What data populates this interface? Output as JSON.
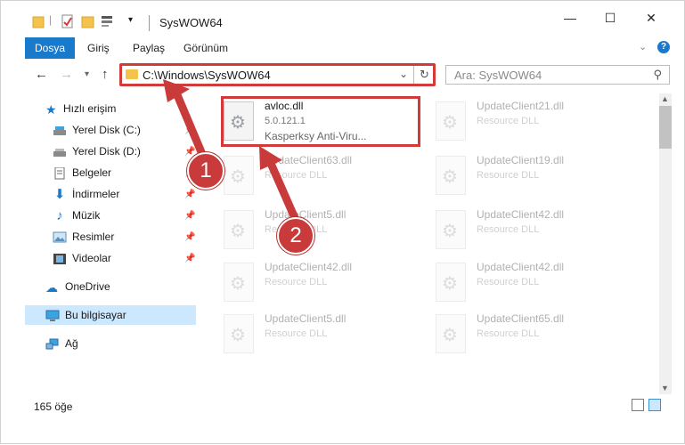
{
  "window": {
    "title": "SysWOW64"
  },
  "window_controls": {
    "minimize": "—",
    "maximize": "☐",
    "close": "✕"
  },
  "ribbon": {
    "tabs": [
      "Dosya",
      "Giriş",
      "Paylaş",
      "Görünüm"
    ],
    "help": "?"
  },
  "nav": {
    "address": "C:\\Windows\\SysWOW64",
    "search_placeholder": "Ara: SysWOW64"
  },
  "sidebar": {
    "items": [
      {
        "label": "Hızlı erişim",
        "icon": "star-icon",
        "pinned": false
      },
      {
        "label": "Yerel Disk (C:)",
        "icon": "drive-icon",
        "pinned": true
      },
      {
        "label": "Yerel Disk (D:)",
        "icon": "drive-icon",
        "pinned": true
      },
      {
        "label": "Belgeler",
        "icon": "documents-icon",
        "pinned": true
      },
      {
        "label": "İndirmeler",
        "icon": "download-icon",
        "pinned": true
      },
      {
        "label": "Müzik",
        "icon": "music-icon",
        "pinned": true
      },
      {
        "label": "Resimler",
        "icon": "pictures-icon",
        "pinned": true
      },
      {
        "label": "Videolar",
        "icon": "videos-icon",
        "pinned": true
      },
      {
        "label": "OneDrive",
        "icon": "cloud-icon",
        "pinned": false
      },
      {
        "label": "Bu bilgisayar",
        "icon": "computer-icon",
        "pinned": false,
        "selected": true
      },
      {
        "label": "Ağ",
        "icon": "network-icon",
        "pinned": false
      }
    ]
  },
  "files": [
    {
      "name": "avloc.dll",
      "line2": "5.0.121.1",
      "line3": "Kasperksy Anti-Viru...",
      "highlighted": true
    },
    {
      "name": "UpdateClient21.dll",
      "line2": "Resource DLL"
    },
    {
      "name": "UpdateClient63.dll",
      "line2": "Resource DLL"
    },
    {
      "name": "UpdateClient19.dll",
      "line2": "Resource DLL"
    },
    {
      "name": "UpdateClient5.dll",
      "line2": "Resource DLL"
    },
    {
      "name": "UpdateClient42.dll",
      "line2": "Resource DLL"
    },
    {
      "name": "UpdateClient42.dll",
      "line2": "Resource DLL"
    },
    {
      "name": "UpdateClient42.dll",
      "line2": "Resource DLL"
    },
    {
      "name": "UpdateClient5.dll",
      "line2": "Resource DLL"
    },
    {
      "name": "UpdateClient65.dll",
      "line2": "Resource DLL"
    }
  ],
  "callouts": [
    "1",
    "2"
  ],
  "status": {
    "count": "165 öğe"
  },
  "colors": {
    "accent": "#1979ca",
    "highlight": "#d33b3b",
    "selection": "#cce8ff"
  }
}
